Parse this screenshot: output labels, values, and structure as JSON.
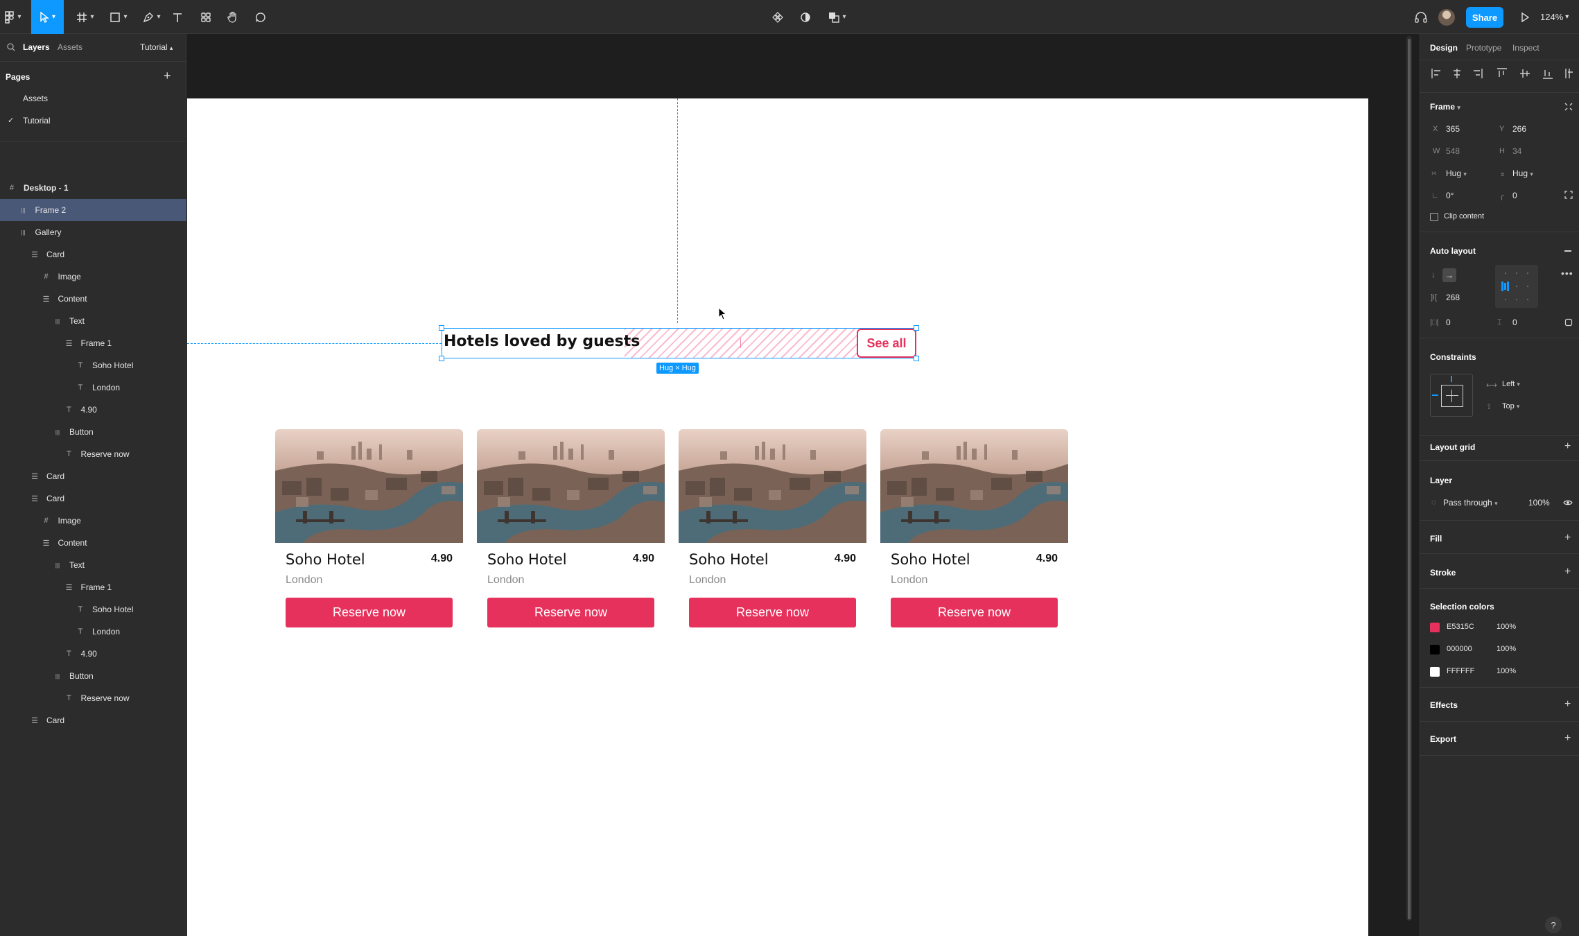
{
  "toolbar": {
    "share_label": "Share",
    "zoom": "124%"
  },
  "left_panel": {
    "tabs": [
      "Layers",
      "Assets"
    ],
    "page_switcher": "Tutorial",
    "pages_heading": "Pages",
    "pages": [
      "Assets",
      "Tutorial"
    ],
    "current_page": "Tutorial",
    "layers": [
      {
        "name": "Desktop - 1",
        "icon": "frame-icon",
        "indent": 0
      },
      {
        "name": "Frame 2",
        "icon": "auto-layout-icon",
        "indent": 1,
        "selected": true
      },
      {
        "name": "Gallery",
        "icon": "auto-layout-icon",
        "indent": 1
      },
      {
        "name": "Card",
        "icon": "vertical-layout-icon",
        "indent": 2
      },
      {
        "name": "Image",
        "icon": "frame-icon",
        "indent": 3
      },
      {
        "name": "Content",
        "icon": "vertical-layout-icon",
        "indent": 3
      },
      {
        "name": "Text",
        "icon": "auto-layout-icon",
        "indent": 4
      },
      {
        "name": "Frame 1",
        "icon": "vertical-layout-icon",
        "indent": 5
      },
      {
        "name": "Soho Hotel",
        "icon": "text-icon",
        "indent": 6
      },
      {
        "name": "London",
        "icon": "text-icon",
        "indent": 6
      },
      {
        "name": "4.90",
        "icon": "text-icon",
        "indent": 5
      },
      {
        "name": "Button",
        "icon": "auto-layout-icon",
        "indent": 4
      },
      {
        "name": "Reserve now",
        "icon": "text-icon",
        "indent": 5
      },
      {
        "name": "Card",
        "icon": "vertical-layout-icon",
        "indent": 2
      },
      {
        "name": "Card",
        "icon": "vertical-layout-icon",
        "indent": 2
      },
      {
        "name": "Image",
        "icon": "frame-icon",
        "indent": 3
      },
      {
        "name": "Content",
        "icon": "vertical-layout-icon",
        "indent": 3
      },
      {
        "name": "Text",
        "icon": "auto-layout-icon",
        "indent": 4
      },
      {
        "name": "Frame 1",
        "icon": "vertical-layout-icon",
        "indent": 5
      },
      {
        "name": "Soho Hotel",
        "icon": "text-icon",
        "indent": 6
      },
      {
        "name": "London",
        "icon": "text-icon",
        "indent": 6
      },
      {
        "name": "4.90",
        "icon": "text-icon",
        "indent": 5
      },
      {
        "name": "Button",
        "icon": "auto-layout-icon",
        "indent": 4
      },
      {
        "name": "Reserve now",
        "icon": "text-icon",
        "indent": 5
      },
      {
        "name": "Card",
        "icon": "vertical-layout-icon",
        "indent": 2
      }
    ]
  },
  "canvas": {
    "heading": "Hotels loved by guests",
    "see_all": "See all",
    "size_badge": "Hug × Hug",
    "accent": "#E5315C",
    "cards": [
      {
        "title": "Soho Hotel",
        "rating": "4.90",
        "city": "London",
        "cta": "Reserve now"
      },
      {
        "title": "Soho Hotel",
        "rating": "4.90",
        "city": "London",
        "cta": "Reserve now"
      },
      {
        "title": "Soho Hotel",
        "rating": "4.90",
        "city": "London",
        "cta": "Reserve now"
      },
      {
        "title": "Soho Hotel",
        "rating": "4.90",
        "city": "London",
        "cta": "Reserve now"
      }
    ]
  },
  "right_panel": {
    "tabs": [
      "Design",
      "Prototype",
      "Inspect"
    ],
    "frame_label": "Frame",
    "x_label": "X",
    "x": "365",
    "y_label": "Y",
    "y": "266",
    "w_label": "W",
    "w": "548",
    "h_label": "H",
    "h": "34",
    "hug_w": "Hug",
    "hug_h": "Hug",
    "rotation": "0°",
    "radius": "0",
    "clip_content": "Clip content",
    "auto_layout": "Auto layout",
    "spacing": "268",
    "padding_h": "0",
    "padding_v": "0",
    "constraints": "Constraints",
    "constraint_h": "Left",
    "constraint_v": "Top",
    "layout_grid": "Layout grid",
    "layer": "Layer",
    "blend": "Pass through",
    "opacity": "100%",
    "fill": "Fill",
    "stroke": "Stroke",
    "selection_colors": "Selection colors",
    "colors": [
      {
        "hex": "E5315C",
        "opacity": "100%",
        "swatch": "#E5315C"
      },
      {
        "hex": "000000",
        "opacity": "100%",
        "swatch": "#000000"
      },
      {
        "hex": "FFFFFF",
        "opacity": "100%",
        "swatch": "#FFFFFF"
      }
    ],
    "effects": "Effects",
    "export": "Export"
  }
}
